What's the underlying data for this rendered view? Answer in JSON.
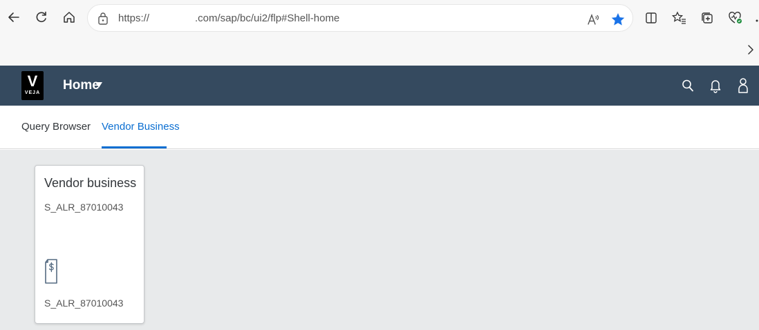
{
  "browser": {
    "url_prefix": "https://",
    "url_path": ".com/sap/bc/ui2/flp#Shell-home"
  },
  "shell": {
    "logo_letter": "V",
    "logo_word": "VEJA",
    "title": "Home",
    "header_color": "#354a5f"
  },
  "tabs": [
    {
      "label": "Query Browser",
      "active": false
    },
    {
      "label": "Vendor Business",
      "active": true
    }
  ],
  "tile": {
    "title": "Vendor business",
    "subtitle": "S_ALR_87010043",
    "icon": "document-dollar-icon",
    "footer": "S_ALR_87010043"
  },
  "colors": {
    "accent": "#0a6ed1",
    "favorite_star": "#1a73e8",
    "content_bg": "#e8eaeb"
  }
}
